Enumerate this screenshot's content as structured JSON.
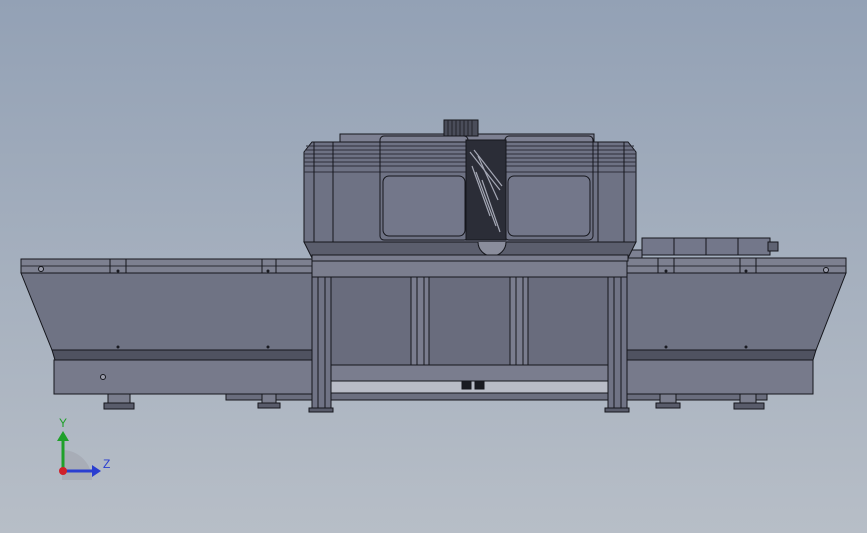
{
  "viewport": {
    "view_name": "Front",
    "background_top": "#93a1b5",
    "background_bottom": "#b7bec7",
    "model_fill": "#6f7384",
    "model_dark": "#5e6272",
    "model_line": "#15161c"
  },
  "triad": {
    "y_label": "Y",
    "z_label": "Z",
    "x_color": "#d0202a",
    "y_color": "#1fa02a",
    "z_color": "#2a3ed0"
  }
}
